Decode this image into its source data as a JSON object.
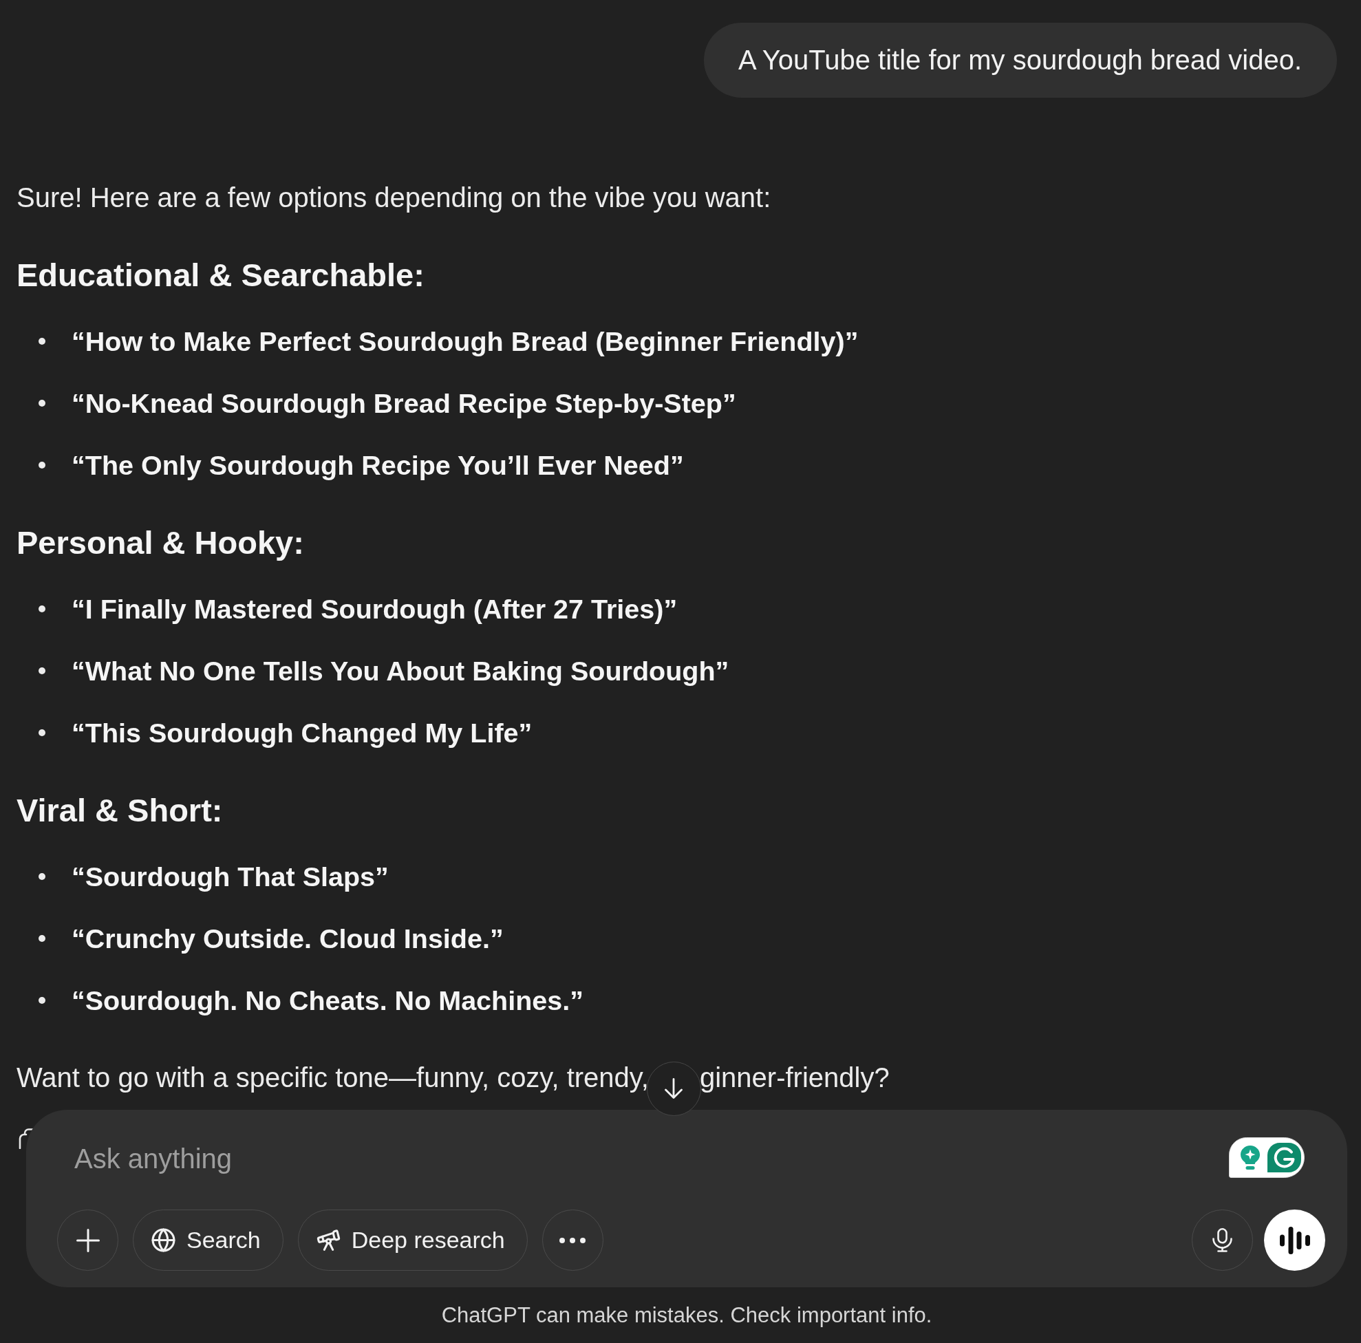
{
  "user_message": {
    "text": "A YouTube title for my sourdough bread video."
  },
  "reply": {
    "intro": "Sure! Here are a few options depending on the vibe you want:",
    "sections": [
      {
        "heading": "Educational & Searchable:",
        "items": [
          "“How to Make Perfect Sourdough Bread (Beginner Friendly)”",
          "“No-Knead Sourdough Bread Recipe Step-by-Step”",
          "“The Only Sourdough Recipe You’ll Ever Need”"
        ]
      },
      {
        "heading": "Personal & Hooky:",
        "items": [
          "“I Finally Mastered Sourdough (After 27 Tries)”",
          "“What No One Tells You About Baking Sourdough”",
          "“This Sourdough Changed My Life”"
        ]
      },
      {
        "heading": "Viral & Short:",
        "items": [
          "“Sourdough That Slaps”",
          "“Crunchy Outside. Cloud Inside.”",
          "“Sourdough. No Cheats. No Machines.”"
        ]
      }
    ],
    "closing": [
      "Want to go with a specific tone—funny, cozy, trendy,",
      "ginner-friendly?"
    ]
  },
  "composer": {
    "placeholder": "Ask anything",
    "tools": [
      {
        "kind": "add"
      },
      {
        "kind": "search",
        "label": "Search"
      },
      {
        "kind": "research",
        "label": "Deep research"
      },
      {
        "kind": "more"
      }
    ]
  },
  "footer": "ChatGPT can make mistakes. Check important info."
}
